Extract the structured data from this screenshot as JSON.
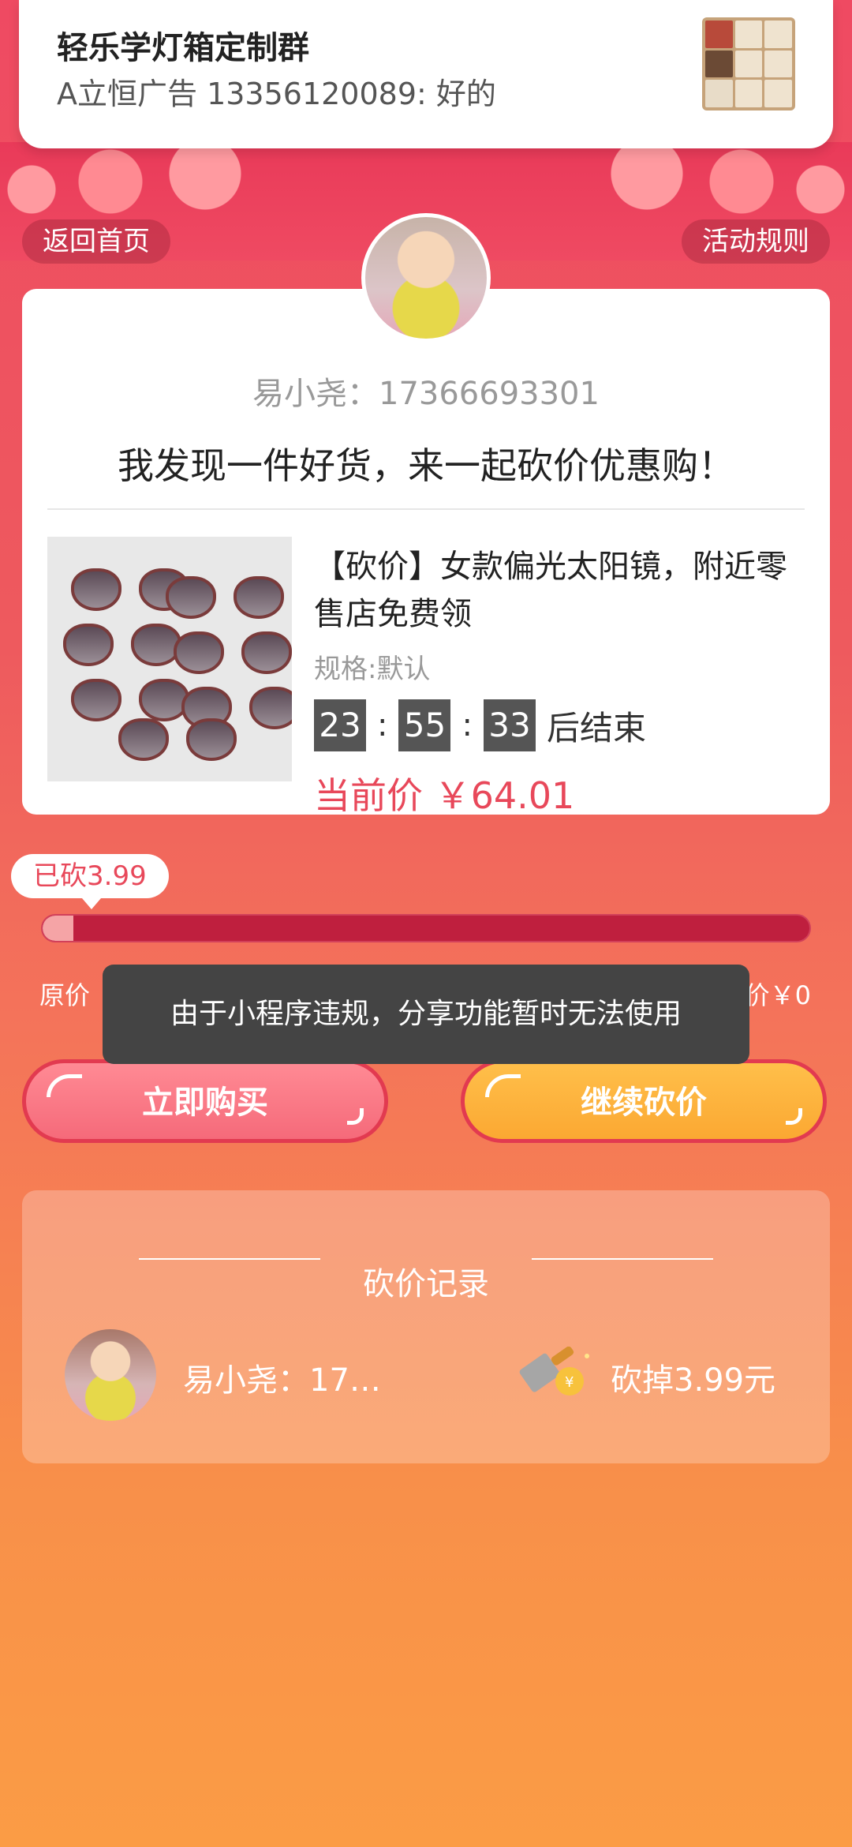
{
  "notification": {
    "title": "轻乐学灯箱定制群",
    "message": "A立恒广告 13356120089: 好的"
  },
  "header": {
    "back_label": "返回首页",
    "rules_label": "活动规则"
  },
  "card": {
    "user_line": "易小尧：17366693301",
    "slogan": "我发现一件好货，来一起砍价优惠购！",
    "product": {
      "title": "【砍价】女款偏光太阳镜，附近零售店免费领",
      "spec": "规格:默认",
      "countdown": {
        "hours": "23",
        "minutes": "55",
        "seconds": "33",
        "sep": ":",
        "suffix": "后结束"
      },
      "price": "当前价 ￥64.01"
    }
  },
  "progress": {
    "badge": "已砍3.99",
    "fraction": 0.04,
    "orig_label": "原价",
    "final_label": "价￥0"
  },
  "toast": {
    "text": "由于小程序违规，分享功能暂时无法使用"
  },
  "buttons": {
    "buy": "立即购买",
    "continue": "继续砍价"
  },
  "records": {
    "title": "砍价记录",
    "items": [
      {
        "name": "易小尧：17…",
        "amount": "砍掉3.99元",
        "icon": "knife-coin-icon"
      }
    ]
  },
  "colors": {
    "accent": "#e8485a",
    "progress_track": "#bf1f3e",
    "buy_button": "#f56a7a",
    "continue_button": "#fba832",
    "toast_bg": "#444444"
  }
}
